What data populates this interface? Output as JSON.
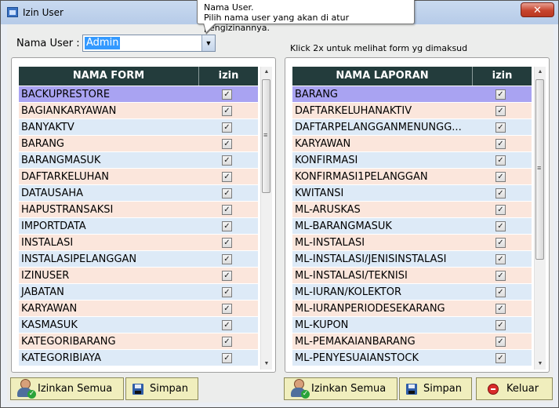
{
  "window": {
    "title": "Izin User",
    "close_label": "✕"
  },
  "user": {
    "label": "Nama User :",
    "selected": "Admin"
  },
  "tooltip": {
    "line1": "Nama User.",
    "line2": "Pilih nama user yang akan di atur pengizinannya."
  },
  "hint": "Klick 2x untuk melihat form yg dimaksud",
  "form_grid": {
    "col_name": "NAMA FORM",
    "col_izin": "izin",
    "rows": [
      {
        "name": "BACKUPRESTORE",
        "checked": true
      },
      {
        "name": "BAGIANKARYAWAN",
        "checked": true
      },
      {
        "name": "BANYAKTV",
        "checked": true
      },
      {
        "name": "BARANG",
        "checked": true
      },
      {
        "name": "BARANGMASUK",
        "checked": true
      },
      {
        "name": "DAFTARKELUHAN",
        "checked": true
      },
      {
        "name": "DATAUSAHA",
        "checked": true
      },
      {
        "name": "HAPUSTRANSAKSI",
        "checked": true
      },
      {
        "name": "IMPORTDATA",
        "checked": true
      },
      {
        "name": "INSTALASI",
        "checked": true
      },
      {
        "name": "INSTALASIPELANGGAN",
        "checked": true
      },
      {
        "name": "IZINUSER",
        "checked": true
      },
      {
        "name": "JABATAN",
        "checked": true
      },
      {
        "name": "KARYAWAN",
        "checked": true
      },
      {
        "name": "KASMASUK",
        "checked": true
      },
      {
        "name": "KATEGORIBARANG",
        "checked": true
      },
      {
        "name": "KATEGORIBIAYA",
        "checked": true
      }
    ]
  },
  "report_grid": {
    "col_name": "NAMA LAPORAN",
    "col_izin": "izin",
    "rows": [
      {
        "name": "BARANG",
        "checked": true
      },
      {
        "name": "DAFTARKELUHANAKTIV",
        "checked": true
      },
      {
        "name": "DAFTARPELANGGANMENUNGG...",
        "checked": true
      },
      {
        "name": "KARYAWAN",
        "checked": true
      },
      {
        "name": "KONFIRMASI",
        "checked": true
      },
      {
        "name": "KONFIRMASI1PELANGGAN",
        "checked": true
      },
      {
        "name": "KWITANSI",
        "checked": true
      },
      {
        "name": "ML-ARUSKAS",
        "checked": true
      },
      {
        "name": "ML-BARANGMASUK",
        "checked": true
      },
      {
        "name": "ML-INSTALASI",
        "checked": true
      },
      {
        "name": "ML-INSTALASI/JENISINSTALASI",
        "checked": true
      },
      {
        "name": "ML-INSTALASI/TEKNISI",
        "checked": true
      },
      {
        "name": "ML-IURAN/KOLEKTOR",
        "checked": true
      },
      {
        "name": "ML-IURANPERIODESEKARANG",
        "checked": true
      },
      {
        "name": "ML-KUPON",
        "checked": true
      },
      {
        "name": "ML-PEMAKAIANBARANG",
        "checked": true
      },
      {
        "name": "ML-PENYESUAIANSTOCK",
        "checked": true
      }
    ]
  },
  "buttons": {
    "izinkan_semua": "Izinkan Semua",
    "simpan": "Simpan",
    "keluar": "Keluar"
  },
  "colors": {
    "header_bg": "#233c3c",
    "row_blue": "#ddeaf7",
    "row_pink": "#fbe6dc",
    "row_selected": "#a9a3f2",
    "button_bg": "#f0eebd"
  }
}
